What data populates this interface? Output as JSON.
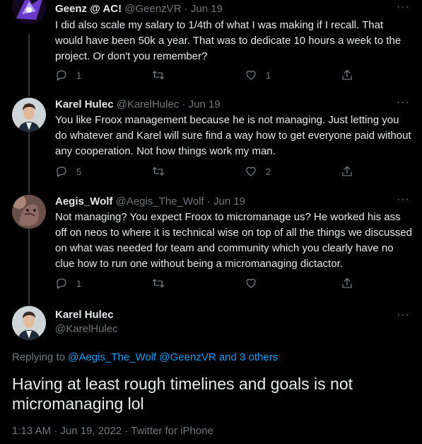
{
  "tweets": [
    {
      "name": "Geenz @ AC!",
      "handle": "@GeenzVR",
      "date": "Jun 19",
      "text": "I did also scale my salary to 1/4th of what I was making if I recall.  That would have been 50k a year.  That was to dedicate 10 hours a week to the project.  Or don't you remember?",
      "replies": "1",
      "retweets": "",
      "likes": "1"
    },
    {
      "name": "Karel Hulec",
      "handle": "@KarelHulec",
      "date": "Jun 19",
      "text": "You like Froox management because he is not managing. Just letting you do whatever and Karel will sure find a way how to get everyone paid without any cooperation. Not how things work my man.",
      "replies": "5",
      "retweets": "",
      "likes": "2"
    },
    {
      "name": "Aegis_Wolf",
      "handle": "@Aegis_The_Wolf",
      "date": "Jun 19",
      "text": "Not managing? You expect Froox to micromanage us? He worked his ass off on neos to where it is technical wise on top of all the things we discussed on what was needed for team and community which you clearly have no clue how to run one without being a micromanaging dictactor.",
      "replies": "1",
      "retweets": "",
      "likes": ""
    }
  ],
  "main": {
    "name": "Karel Hulec",
    "handle": "@KarelHulec",
    "replying_prefix": "Replying to ",
    "replying_handles": "@Aegis_The_Wolf @GeenzVR",
    "replying_and": " and ",
    "replying_others": "3 others",
    "text": "Having at least rough timelines and goals is not micromanaging lol",
    "timestamp": "1:13 AM · Jun 19, 2022 · Twitter for iPhone"
  },
  "icons": {
    "reply": "reply-icon",
    "retweet": "retweet-icon",
    "like": "like-icon",
    "share": "share-icon",
    "more": "more-icon"
  },
  "colors": {
    "background": "#000000",
    "text": "#e7e9ea",
    "muted": "#71767b",
    "link": "#1d9bf0"
  }
}
